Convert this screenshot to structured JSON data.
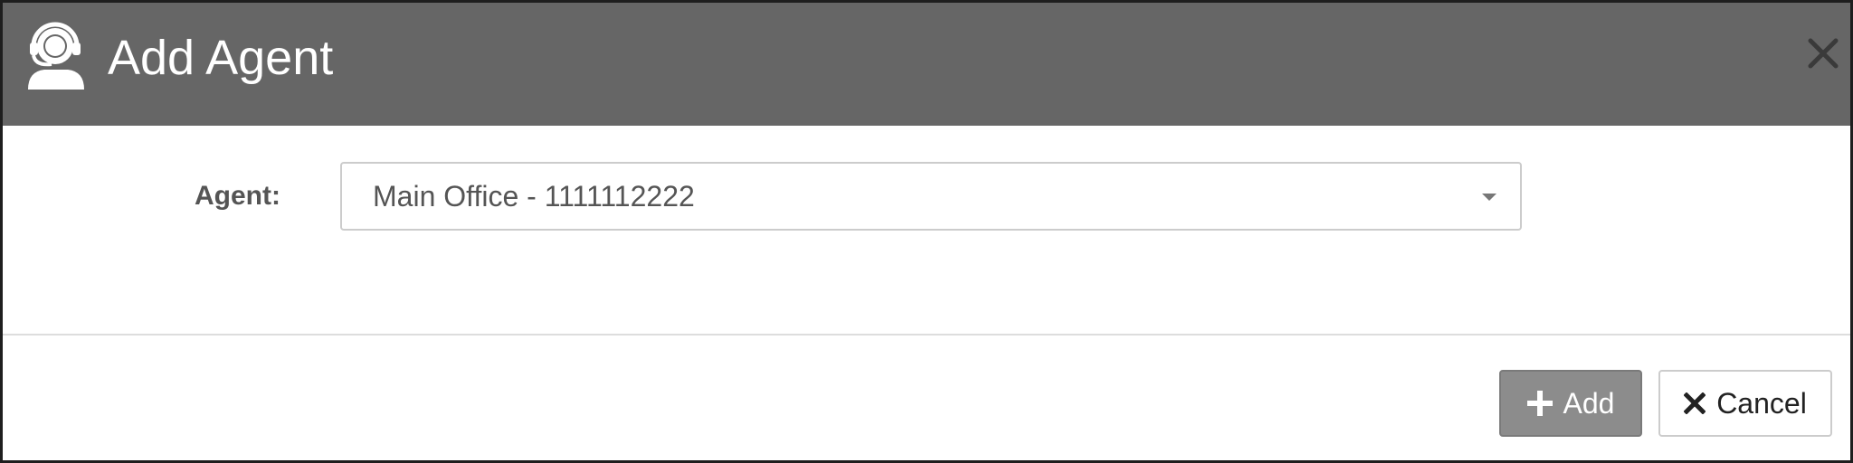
{
  "dialog": {
    "title": "Add Agent",
    "icon": "agent-headset-icon",
    "close_icon": "close-icon"
  },
  "form": {
    "agent_label": "Agent:",
    "agent_value": "Main Office - 1111112222",
    "caret_icon": "chevron-down-icon"
  },
  "footer": {
    "add_label": "Add",
    "add_icon": "plus-icon",
    "cancel_label": "Cancel",
    "cancel_icon": "x-icon"
  },
  "colors": {
    "header_bg": "#666666",
    "add_button_bg": "#8c8c8c",
    "text_gray": "#555555"
  }
}
